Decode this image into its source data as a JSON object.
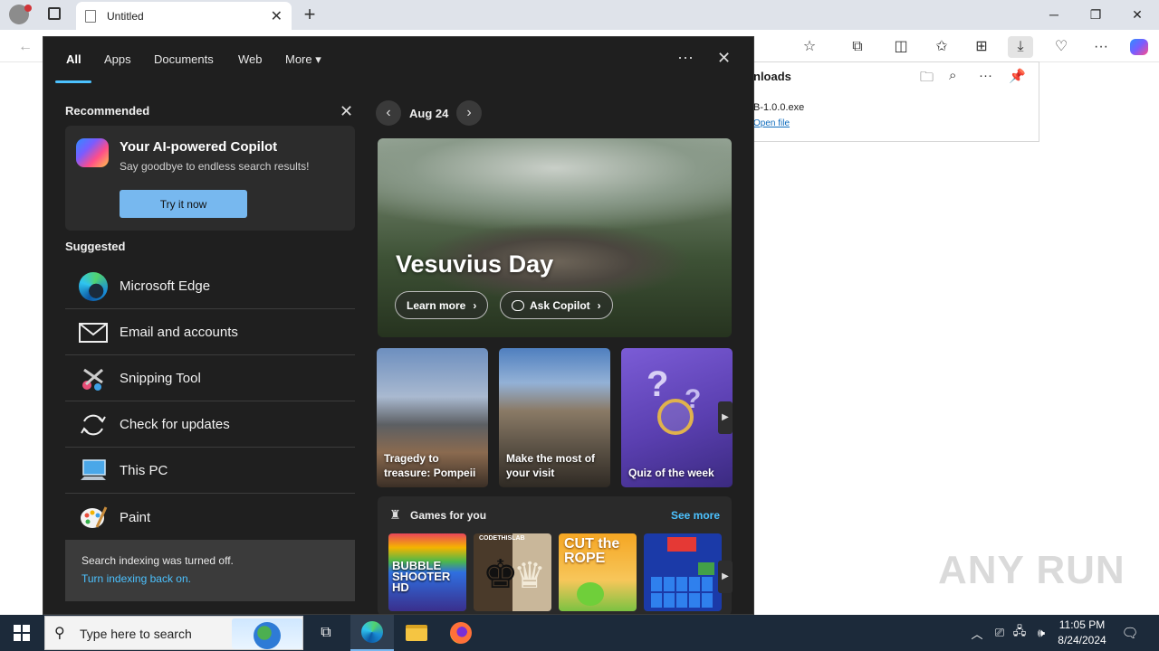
{
  "browser": {
    "tab_title": "Untitled",
    "new_tab": "+",
    "window_controls": [
      "─",
      "❐",
      "✕"
    ]
  },
  "downloads": {
    "title": "nloads",
    "file_name": "B-1.0.0.exe",
    "open_file": "Open file"
  },
  "search_panel": {
    "tabs": [
      "All",
      "Apps",
      "Documents",
      "Web",
      "More"
    ],
    "more_icon": "▾",
    "options_icon": "···",
    "close_icon": "✕",
    "recommended_label": "Recommended",
    "copilot": {
      "title": "Your AI-powered Copilot",
      "subtitle": "Say goodbye to endless search results!",
      "button": "Try it now"
    },
    "suggested_label": "Suggested",
    "apps": [
      {
        "label": "Microsoft Edge",
        "icon": "edge-icon"
      },
      {
        "label": "Email and accounts",
        "icon": "mail-icon"
      },
      {
        "label": "Snipping Tool",
        "icon": "scissors-icon"
      },
      {
        "label": "Check for updates",
        "icon": "refresh-icon"
      },
      {
        "label": "This PC",
        "icon": "computer-icon"
      },
      {
        "label": "Paint",
        "icon": "palette-icon"
      }
    ],
    "indexing": {
      "message": "Search indexing was turned off.",
      "link": "Turn indexing back on."
    },
    "date": "Aug 24",
    "hero": {
      "title": "Vesuvius Day",
      "learn_more": "Learn more",
      "ask_copilot": "Ask Copilot"
    },
    "cards": [
      {
        "title": "Tragedy to treasure: Pompeii"
      },
      {
        "title": "Make the most of your visit"
      },
      {
        "title": "Quiz of the week"
      }
    ],
    "games": {
      "title": "Games for you",
      "see_more": "See more",
      "tiles": [
        {
          "label": "BUBBLE SHOOTER HD"
        },
        {
          "label": "CODETHISLAB"
        },
        {
          "label": "CUT the ROPE"
        },
        {
          "label": ""
        }
      ]
    }
  },
  "taskbar": {
    "search_placeholder": "Type here to search",
    "time": "11:05 PM",
    "date": "8/24/2024"
  },
  "watermark": "ANY RUN"
}
